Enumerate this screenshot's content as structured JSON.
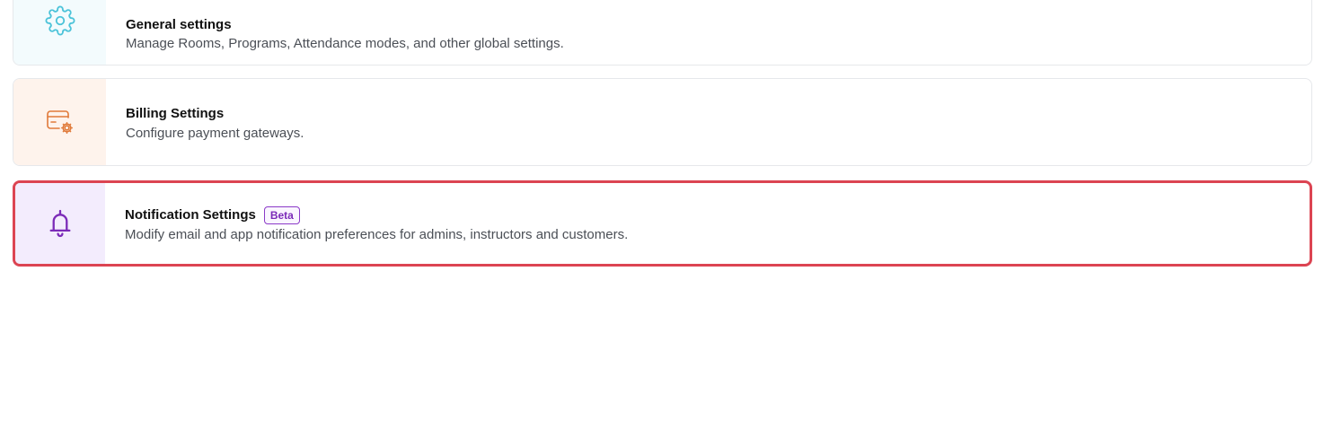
{
  "settings": {
    "general": {
      "title": "General settings",
      "description": "Manage Rooms, Programs, Attendance modes, and other global settings.",
      "icon": "gear-icon",
      "accent": "#4cc3d9"
    },
    "billing": {
      "title": "Billing Settings",
      "description": "Configure payment gateways.",
      "icon": "billing-settings-icon",
      "accent": "#e07a3a"
    },
    "notification": {
      "title": "Notification Settings",
      "badge": "Beta",
      "description": "Modify email and app notification preferences for admins, instructors and customers.",
      "icon": "bell-icon",
      "accent": "#7b2ab8",
      "highlight": "#dc4452"
    }
  }
}
